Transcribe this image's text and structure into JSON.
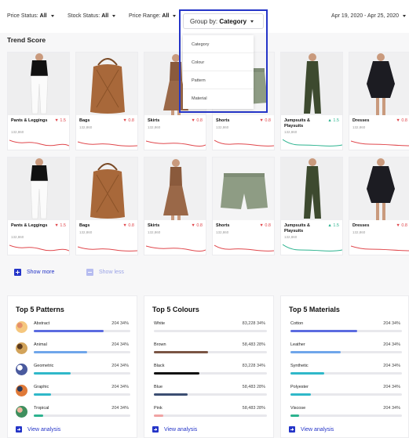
{
  "filters": {
    "price_status": {
      "label": "Price Status:",
      "value": "All"
    },
    "stock_status": {
      "label": "Stock Status:",
      "value": "All"
    },
    "price_range": {
      "label": "Price Range:",
      "value": "All"
    },
    "group_by": {
      "label": "Group by:",
      "value": "Category"
    },
    "date_range": "Apr 19, 2020 - Apr 25, 2020"
  },
  "group_menu": [
    "Category",
    "Colour",
    "Pattern",
    "Material"
  ],
  "trend_title": "Trend Score",
  "cards": [
    {
      "name": "Pants & Leggings",
      "change": "1.5",
      "direction": "down",
      "count": "132,860",
      "color": "#e0474c"
    },
    {
      "name": "Bags",
      "change": "0.8",
      "direction": "down",
      "count": "132,860",
      "color": "#e0474c"
    },
    {
      "name": "Skirts",
      "change": "0.8",
      "direction": "down",
      "count": "132,860",
      "color": "#e0474c"
    },
    {
      "name": "Shorts",
      "change": "0.8",
      "direction": "down",
      "count": "132,860",
      "color": "#e0474c"
    },
    {
      "name": "Jumpsuits & Playsuits",
      "change": "1.5",
      "direction": "up",
      "count": "132,860",
      "color": "#2cb38f"
    },
    {
      "name": "Dresses",
      "change": "0.8",
      "direction": "down",
      "count": "132,860",
      "color": "#e0474c"
    }
  ],
  "show_more": "Show more",
  "show_less": "Show less",
  "panels": [
    {
      "title": "Top 5 Patterns",
      "rows": [
        {
          "label": "Abstract",
          "value": "204 34%",
          "fill": 0.72,
          "color": "#5b6be0"
        },
        {
          "label": "Animal",
          "value": "204 34%",
          "fill": 0.55,
          "color": "#6fa6ea"
        },
        {
          "label": "Geometric",
          "value": "204 34%",
          "fill": 0.38,
          "color": "#2fb8c9"
        },
        {
          "label": "Graphic",
          "value": "204 34%",
          "fill": 0.18,
          "color": "#2fb8c9"
        },
        {
          "label": "Tropical",
          "value": "204 34%",
          "fill": 0.1,
          "color": "#2cb38f"
        }
      ],
      "footer": "View analysis"
    },
    {
      "title": "Top 5 Colours",
      "rows": [
        {
          "label": "White",
          "value": "83,228 34%",
          "fill": 0.0,
          "color": "#ffffff"
        },
        {
          "label": "Brown",
          "value": "58,483 28%",
          "fill": 0.48,
          "color": "#7a5544"
        },
        {
          "label": "Black",
          "value": "83,228 34%",
          "fill": 0.4,
          "color": "#111111"
        },
        {
          "label": "Blue",
          "value": "58,483 28%",
          "fill": 0.3,
          "color": "#3b4e72"
        },
        {
          "label": "Pink",
          "value": "58,483 28%",
          "fill": 0.08,
          "color": "#f0a3a3"
        }
      ],
      "footer": "View analysis"
    },
    {
      "title": "Top 5 Materials",
      "rows": [
        {
          "label": "Cotton",
          "value": "204 34%",
          "fill": 0.6,
          "color": "#5b6be0"
        },
        {
          "label": "Leather",
          "value": "204 34%",
          "fill": 0.45,
          "color": "#6fa6ea"
        },
        {
          "label": "Synthetic",
          "value": "204 34%",
          "fill": 0.3,
          "color": "#2fb8c9"
        },
        {
          "label": "Polyester",
          "value": "204 34%",
          "fill": 0.18,
          "color": "#2fb8c9"
        },
        {
          "label": "Viscose",
          "value": "204 34%",
          "fill": 0.08,
          "color": "#2cb38f"
        }
      ],
      "footer": "View analysis"
    }
  ]
}
